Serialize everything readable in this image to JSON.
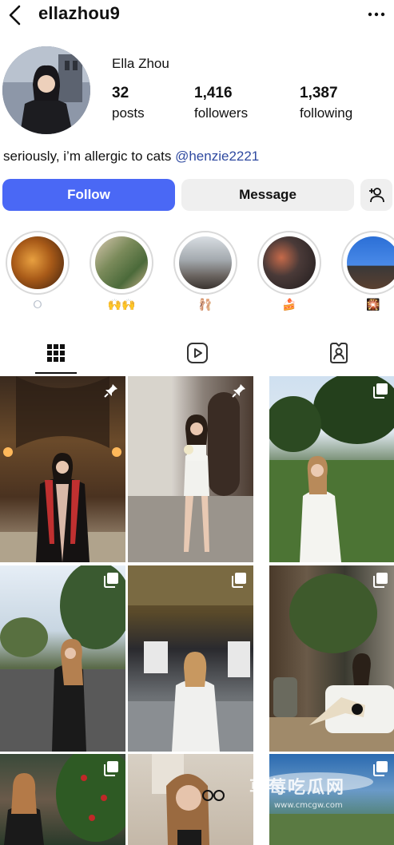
{
  "header": {
    "username": "ellazhou9"
  },
  "profile": {
    "display_name": "Ella Zhou",
    "stats": {
      "posts": {
        "value": "32",
        "label": "posts"
      },
      "followers": {
        "value": "1,416",
        "label": "followers"
      },
      "following": {
        "value": "1,387",
        "label": "following"
      }
    },
    "bio_text": "seriously, i’m allergic to cats ",
    "bio_mention": "@henzie2221"
  },
  "actions": {
    "follow_label": "Follow",
    "message_label": "Message",
    "add_user_icon": "person-add-icon"
  },
  "highlights": [
    {
      "label": "⭘",
      "icon": "stairs-photo"
    },
    {
      "label": "🙌🙌",
      "icon": "drinks-photo"
    },
    {
      "label": "🩰",
      "icon": "window-photo"
    },
    {
      "label": "🍰",
      "icon": "restaurant-photo"
    },
    {
      "label": "🎇",
      "icon": "temple-photo"
    }
  ],
  "tabs": [
    {
      "name": "posts",
      "icon": "grid-icon",
      "active": true
    },
    {
      "name": "reels",
      "icon": "reels-icon",
      "active": false
    },
    {
      "name": "tagged",
      "icon": "tagged-icon",
      "active": false
    }
  ],
  "grid": [
    {
      "type": "pinned",
      "icon": "pin-icon"
    },
    {
      "type": "pinned",
      "icon": "pin-icon"
    },
    {
      "type": "carousel",
      "icon": "carousel-icon"
    },
    {
      "type": "carousel",
      "icon": "carousel-icon"
    },
    {
      "type": "carousel",
      "icon": "carousel-icon"
    },
    {
      "type": "carousel",
      "icon": "carousel-icon"
    },
    {
      "type": "carousel",
      "icon": "carousel-icon"
    },
    {
      "type": "carousel",
      "icon": "carousel-icon"
    },
    {
      "type": "carousel",
      "icon": "carousel-icon"
    }
  ],
  "watermark": {
    "text": "草莓吃瓜网",
    "url": "www.cmcgw.com"
  },
  "colors": {
    "follow_button": "#4a68f5",
    "secondary_button": "#efefef",
    "mention": "#2f4aa0"
  }
}
